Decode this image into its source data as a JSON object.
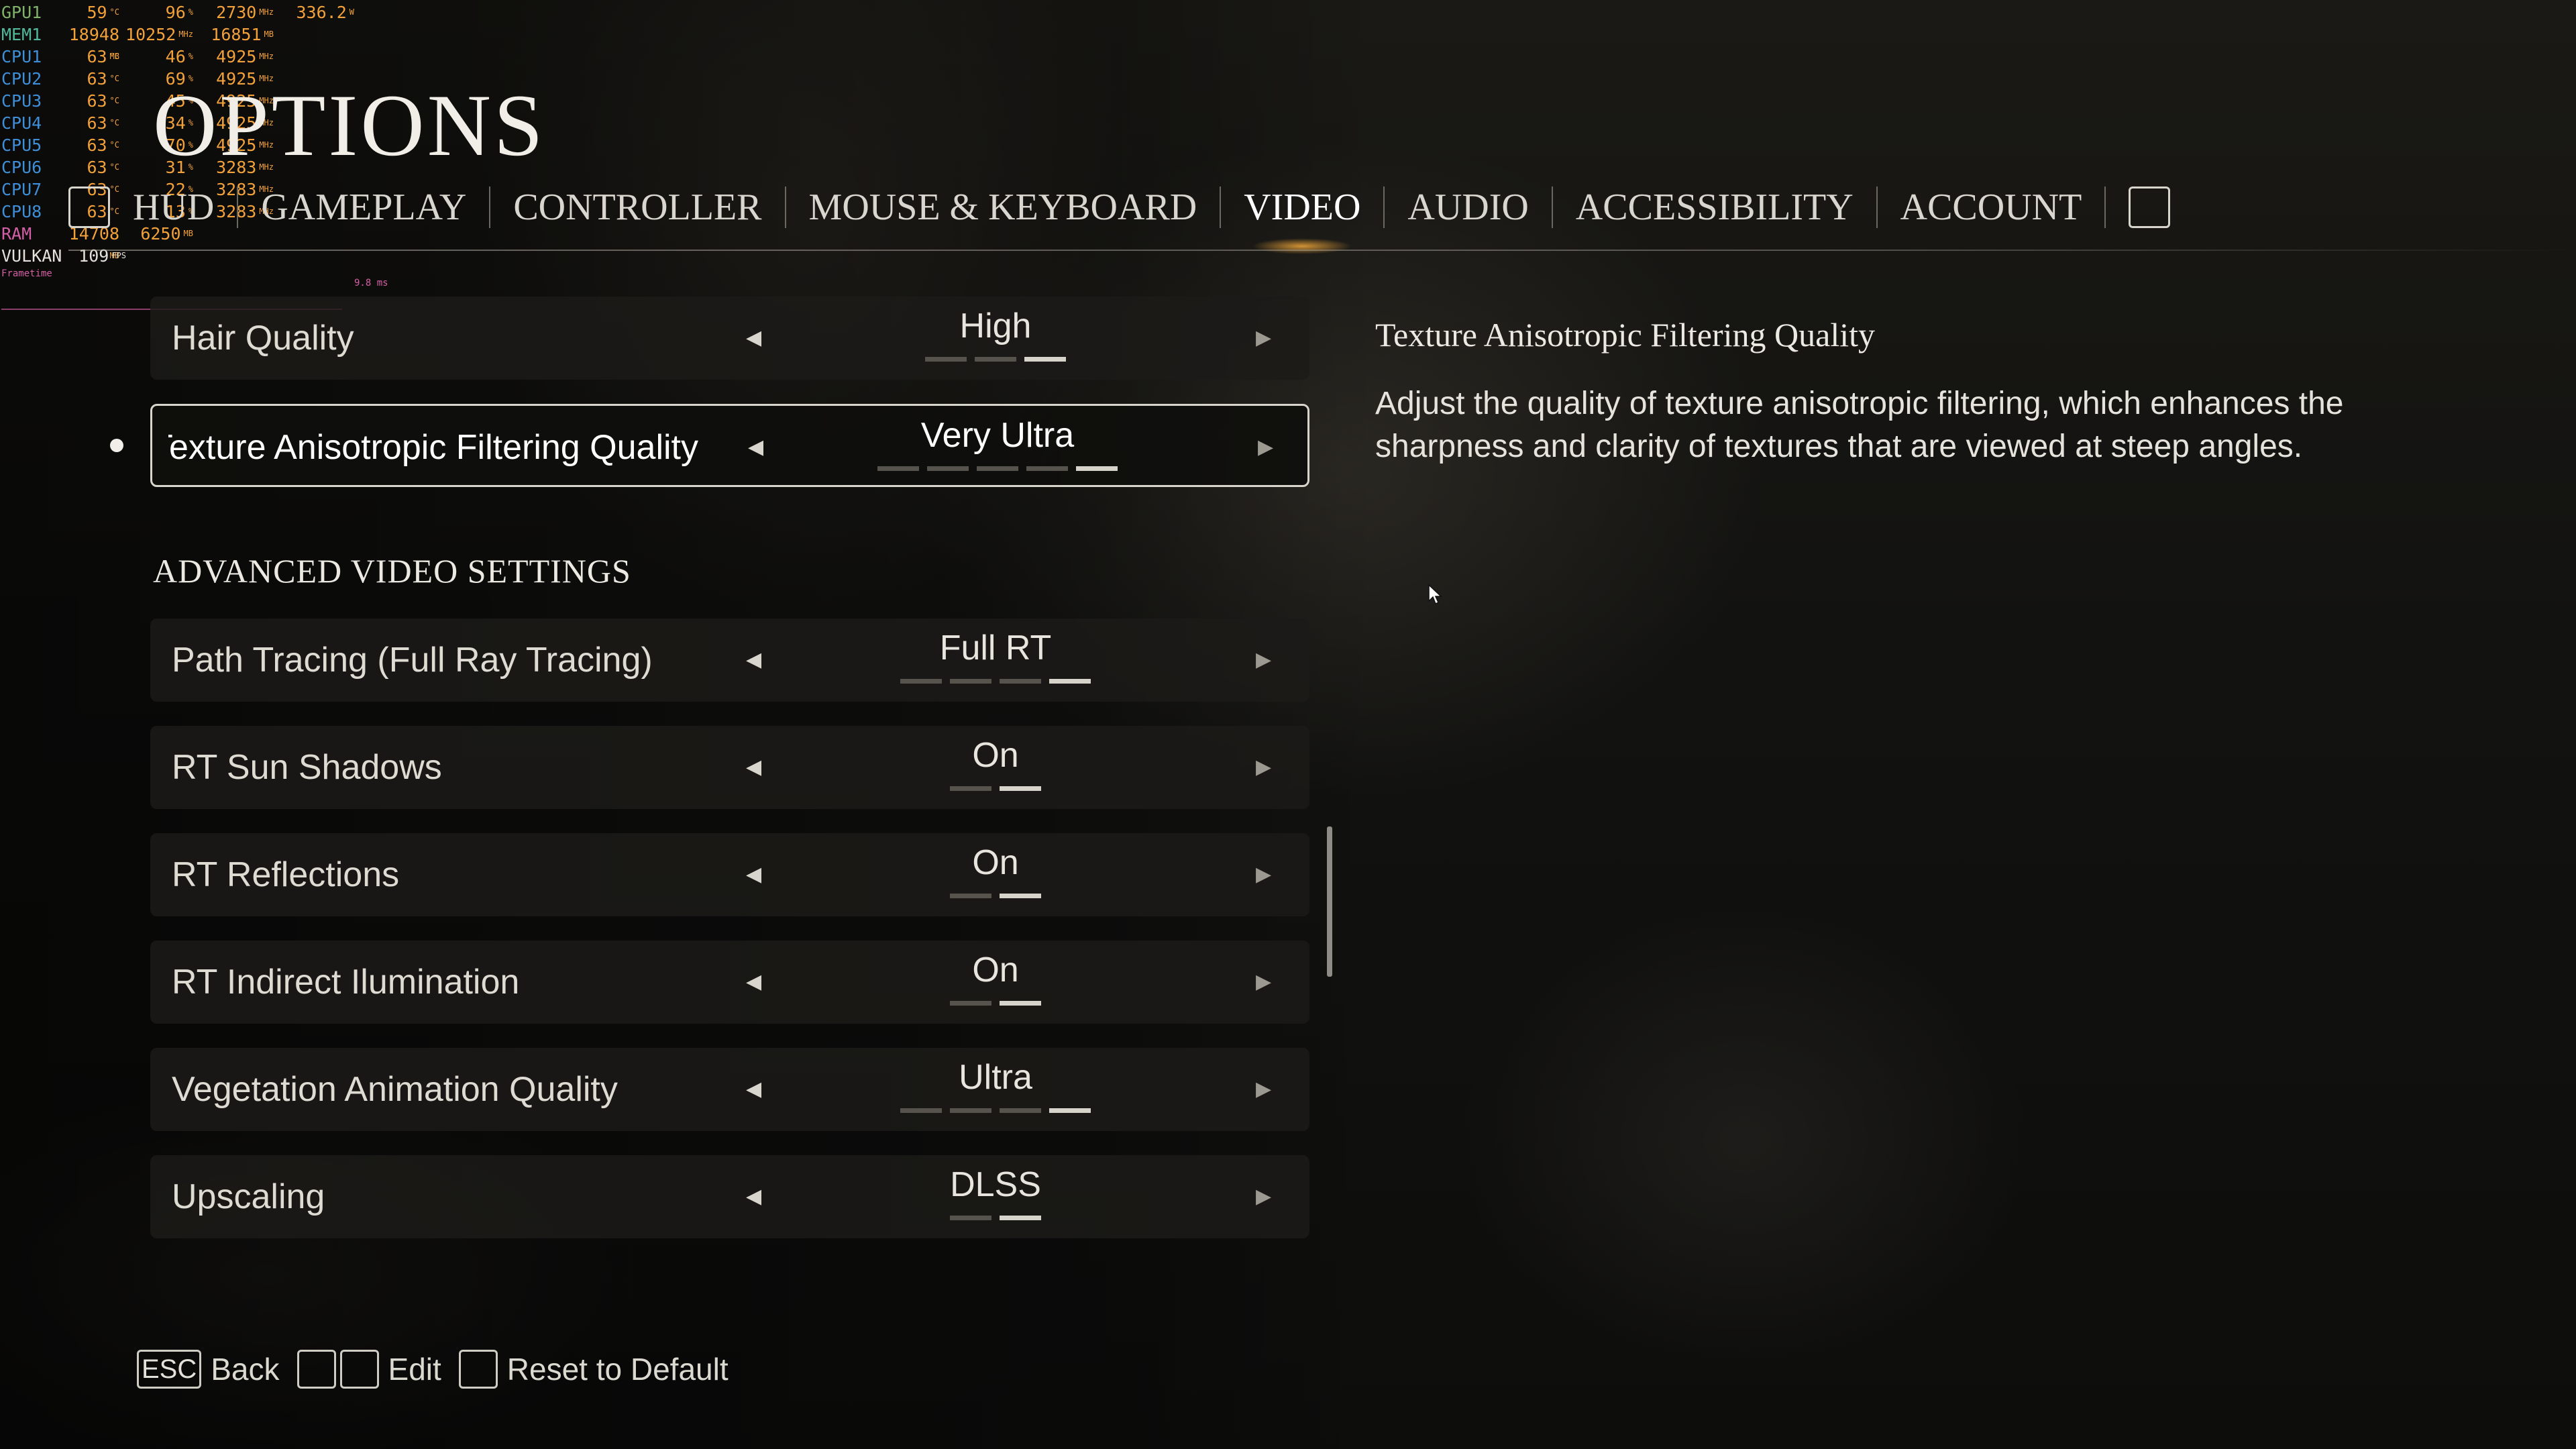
{
  "osd": {
    "rows": [
      {
        "label": "GPU",
        "sub": "1",
        "v1": "59",
        "u1": "°C",
        "v2": "96",
        "u2": "%",
        "v3": "2730",
        "u3": "MHz",
        "v4": "336.2",
        "u4": "W",
        "color": "gpu"
      },
      {
        "label": "MEM",
        "sub": "1",
        "v1": "18948",
        "u1": "MB",
        "v2": "10252",
        "u2": "MHz",
        "v3": "16851",
        "u3": "MB",
        "v4": "",
        "u4": "",
        "color": "mem"
      },
      {
        "label": "CPU",
        "sub": "1",
        "v1": "63",
        "u1": "°C",
        "v2": "46",
        "u2": "%",
        "v3": "4925",
        "u3": "MHz",
        "v4": "",
        "u4": "",
        "color": "cpu"
      },
      {
        "label": "CPU",
        "sub": "2",
        "v1": "63",
        "u1": "°C",
        "v2": "69",
        "u2": "%",
        "v3": "4925",
        "u3": "MHz",
        "v4": "",
        "u4": "",
        "color": "cpu"
      },
      {
        "label": "CPU",
        "sub": "3",
        "v1": "63",
        "u1": "°C",
        "v2": "45",
        "u2": "%",
        "v3": "4925",
        "u3": "MHz",
        "v4": "",
        "u4": "",
        "color": "cpu"
      },
      {
        "label": "CPU",
        "sub": "4",
        "v1": "63",
        "u1": "°C",
        "v2": "34",
        "u2": "%",
        "v3": "4925",
        "u3": "MHz",
        "v4": "",
        "u4": "",
        "color": "cpu"
      },
      {
        "label": "CPU",
        "sub": "5",
        "v1": "63",
        "u1": "°C",
        "v2": "70",
        "u2": "%",
        "v3": "4925",
        "u3": "MHz",
        "v4": "",
        "u4": "",
        "color": "cpu"
      },
      {
        "label": "CPU",
        "sub": "6",
        "v1": "63",
        "u1": "°C",
        "v2": "31",
        "u2": "%",
        "v3": "3283",
        "u3": "MHz",
        "v4": "",
        "u4": "",
        "color": "cpu"
      },
      {
        "label": "CPU",
        "sub": "7",
        "v1": "63",
        "u1": "°C",
        "v2": "22",
        "u2": "%",
        "v3": "3283",
        "u3": "MHz",
        "v4": "",
        "u4": "",
        "color": "cpu"
      },
      {
        "label": "CPU",
        "sub": "8",
        "v1": "63",
        "u1": "°C",
        "v2": "13",
        "u2": "%",
        "v3": "3283",
        "u3": "MHz",
        "v4": "",
        "u4": "",
        "color": "cpu"
      },
      {
        "label": "RAM",
        "sub": "",
        "v1": "14708",
        "u1": "MB",
        "v2": "6250",
        "u2": "MB",
        "v3": "",
        "u3": "",
        "v4": "",
        "u4": "",
        "color": "ram"
      },
      {
        "label": "VULKAN",
        "sub": "",
        "v1": "109",
        "u1": "FPS",
        "v2": "",
        "u2": "",
        "v3": "",
        "u3": "",
        "v4": "",
        "u4": "",
        "color": "vk"
      }
    ],
    "frametime_label": "Frametime",
    "frametime_ms": "9.8 ms"
  },
  "page_title": "OPTIONS",
  "tabs": [
    {
      "label": "HUD"
    },
    {
      "label": "GAMEPLAY"
    },
    {
      "label": "CONTROLLER"
    },
    {
      "label": "MOUSE & KEYBOARD"
    },
    {
      "label": "VIDEO",
      "active": true
    },
    {
      "label": "AUDIO"
    },
    {
      "label": "ACCESSIBILITY"
    },
    {
      "label": "ACCOUNT"
    }
  ],
  "settings": {
    "hair_quality": {
      "label": "Hair Quality",
      "value": "High",
      "levels_total": 3,
      "level": 3
    },
    "texture_af": {
      "label": "Texture Anisotropic Filtering Quality",
      "value": "Very Ultra",
      "levels_total": 5,
      "level": 5,
      "selected": true
    },
    "section_heading": "ADVANCED VIDEO SETTINGS",
    "path_tracing": {
      "label": "Path Tracing (Full Ray Tracing)",
      "value": "Full RT",
      "levels_total": 4,
      "level": 4
    },
    "rt_sun_shadows": {
      "label": "RT Sun Shadows",
      "value": "On",
      "levels_total": 2,
      "level": 2
    },
    "rt_reflections": {
      "label": "RT Reflections",
      "value": "On",
      "levels_total": 2,
      "level": 2
    },
    "rt_indirect": {
      "label": "RT Indirect Ilumination",
      "value": "On",
      "levels_total": 2,
      "level": 2
    },
    "vegetation": {
      "label": "Vegetation Animation Quality",
      "value": "Ultra",
      "levels_total": 4,
      "level": 4
    },
    "upscaling": {
      "label": "Upscaling",
      "value": "DLSS",
      "levels_total": 2,
      "level": 2
    }
  },
  "description": {
    "title": "Texture Anisotropic Filtering Quality",
    "body": "Adjust the quality of texture anisotropic filtering, which enhances the sharpness and clarity of textures that are viewed at steep angles."
  },
  "footer": {
    "esc_key": "ESC",
    "back_label": "Back",
    "edit_label": "Edit",
    "reset_label": "Reset to Default"
  },
  "colors": {
    "accent_glow": "#ffb03c",
    "text": "#e4e1da",
    "row_bg": "#1c1b18"
  },
  "icons": {
    "cursor": "mouse-pointer-icon",
    "arrows": [
      "arrow-left-icon",
      "arrow-right-icon"
    ],
    "tab_keys": [
      "left-bumper-key-icon",
      "right-bumper-key-icon"
    ]
  }
}
